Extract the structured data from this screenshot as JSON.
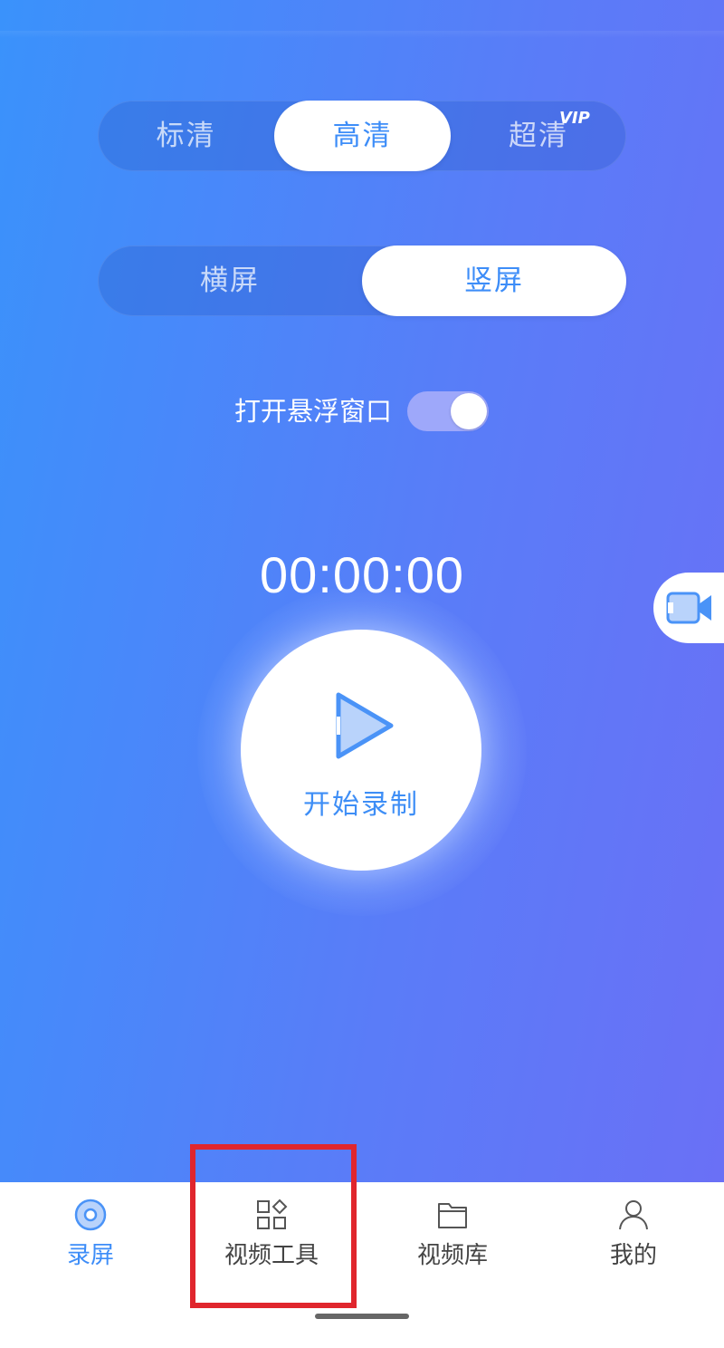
{
  "quality": {
    "options": [
      {
        "label": "标清",
        "active": false
      },
      {
        "label": "高清",
        "active": true
      },
      {
        "label": "超清",
        "active": false,
        "badge": "VIP"
      }
    ]
  },
  "orientation": {
    "options": [
      {
        "label": "横屏",
        "active": false
      },
      {
        "label": "竖屏",
        "active": true
      }
    ]
  },
  "floating_window": {
    "label": "打开悬浮窗口",
    "enabled": true
  },
  "timer": "00:00:00",
  "record_button": {
    "label": "开始录制",
    "icon": "play-icon"
  },
  "side_button": {
    "icon": "video-camera-icon"
  },
  "tabs": [
    {
      "label": "录屏",
      "icon": "record-disc-icon",
      "active": true
    },
    {
      "label": "视频工具",
      "icon": "tools-grid-icon",
      "active": false
    },
    {
      "label": "视频库",
      "icon": "folder-icon",
      "active": false
    },
    {
      "label": "我的",
      "icon": "person-icon",
      "active": false
    }
  ],
  "colors": {
    "accent": "#3d8df8",
    "gradient_start": "#3a92fb",
    "gradient_end": "#6a70f6",
    "highlight_box": "#e0262d"
  }
}
